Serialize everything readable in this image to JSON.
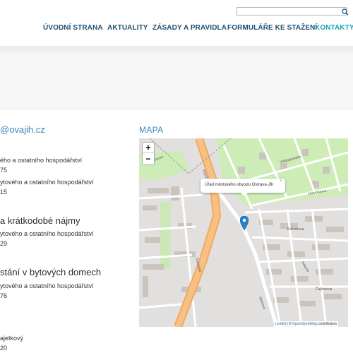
{
  "search": {
    "placeholder": ""
  },
  "nav": {
    "items": [
      {
        "label": "ÚVODNÍ STRANA",
        "active": false
      },
      {
        "label": "AKTUALITY",
        "active": false
      },
      {
        "label": "ZÁSADY A PRAVIDLA",
        "active": false
      },
      {
        "label": "FORMULÁŘE KE STAŽENÍ",
        "active": false
      },
      {
        "label": "KONTAKTY",
        "active": true
      }
    ]
  },
  "contact": {
    "email_fragment": "@ovajih.cz",
    "lines": [
      "ého a ostatního hospodářství",
      "75",
      "ytového a ostatního hospodářství",
      "15"
    ],
    "sections": [
      {
        "heading": "a krátkodobé nájmy",
        "lines": [
          "ytového a ostatního hospodářství",
          "29"
        ]
      },
      {
        "heading": "stání v bytových domech",
        "lines": [
          "ytového a ostatního hospodářství",
          "76"
        ]
      }
    ],
    "footer_lines": [
      "ajetkový",
      "20"
    ]
  },
  "map": {
    "title": "MAPA",
    "zoom_in": "+",
    "zoom_out": "−",
    "popup_text": "Úřad městského obvodu Ostrava-Jih",
    "popup_close": "×",
    "attribution": {
      "leaflet": "Leaflet",
      "separator": " | © ",
      "osm": "OpenStreetMap",
      "suffix": " contributors"
    },
    "colors": {
      "water": "#a9d3de",
      "park": "#c9ebb4",
      "road_major": "#f7b46b",
      "building": "#c9c2bb",
      "marker": "#2a81cb"
    }
  }
}
